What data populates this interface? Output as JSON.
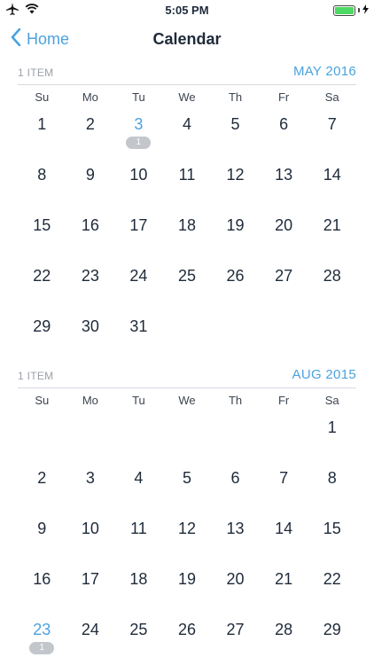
{
  "status_bar": {
    "time": "5:05 PM"
  },
  "nav": {
    "back_label": "Home",
    "title": "Calendar"
  },
  "weekdays": [
    "Su",
    "Mo",
    "Tu",
    "We",
    "Th",
    "Fr",
    "Sa"
  ],
  "months": [
    {
      "label": "MAY 2016",
      "item_count": "1 ITEM",
      "leading_blanks": 0,
      "days": [
        "1",
        "2",
        "3",
        "4",
        "5",
        "6",
        "7",
        "8",
        "9",
        "10",
        "11",
        "12",
        "13",
        "14",
        "15",
        "16",
        "17",
        "18",
        "19",
        "20",
        "21",
        "22",
        "23",
        "24",
        "25",
        "26",
        "27",
        "28",
        "29",
        "30",
        "31"
      ],
      "items": {
        "3": "1"
      }
    },
    {
      "label": "AUG 2015",
      "item_count": "1 ITEM",
      "leading_blanks": 6,
      "days": [
        "1",
        "2",
        "3",
        "4",
        "5",
        "6",
        "7",
        "8",
        "9",
        "10",
        "11",
        "12",
        "13",
        "14",
        "15",
        "16",
        "17",
        "18",
        "19",
        "20",
        "21",
        "22",
        "23",
        "24",
        "25",
        "26",
        "27",
        "28",
        "29"
      ],
      "items": {
        "23": "1"
      }
    }
  ],
  "colors": {
    "accent": "#4aa3df",
    "text": "#1e2a3a",
    "badge": "#c3c6cb",
    "battery": "#4cd964"
  }
}
